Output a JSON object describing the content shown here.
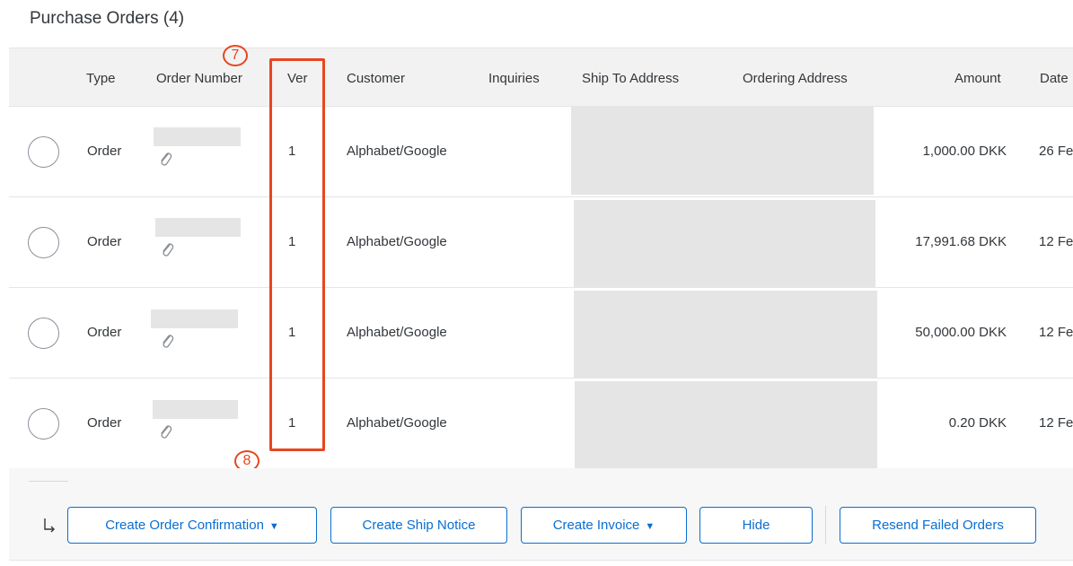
{
  "page": {
    "title": "Purchase Orders (4)"
  },
  "columns": [
    "Type",
    "Order Number",
    "Ver",
    "Customer",
    "Inquiries",
    "Ship To Address",
    "Ordering Address",
    "Amount",
    "Date"
  ],
  "rows": [
    {
      "type": "Order",
      "ver": "1",
      "customer": "Alphabet/Google",
      "amount": "1,000.00 DKK",
      "date": "26 Fe"
    },
    {
      "type": "Order",
      "ver": "1",
      "customer": "Alphabet/Google",
      "amount": "17,991.68 DKK",
      "date": "12 Fe"
    },
    {
      "type": "Order",
      "ver": "1",
      "customer": "Alphabet/Google",
      "amount": "50,000.00 DKK",
      "date": "12 Fe"
    },
    {
      "type": "Order",
      "ver": "1",
      "customer": "Alphabet/Google",
      "amount": "0.20 DKK",
      "date": "12 Fe"
    }
  ],
  "annotations": {
    "step_top": "7",
    "step_bottom": "8",
    "color": "#e8461f"
  },
  "actions": {
    "create_order_confirmation": "Create Order Confirmation",
    "create_ship_notice": "Create Ship Notice",
    "create_invoice": "Create Invoice",
    "hide": "Hide",
    "resend_failed_orders": "Resend Failed Orders",
    "dropdown_caret": "▼"
  },
  "colors": {
    "accent": "#0a6ed1",
    "header_bg": "#f2f2f2",
    "redaction": "#e6e5e5"
  },
  "icons": {
    "attachment": "paperclip-icon",
    "row_action": "return-arrow-icon"
  }
}
